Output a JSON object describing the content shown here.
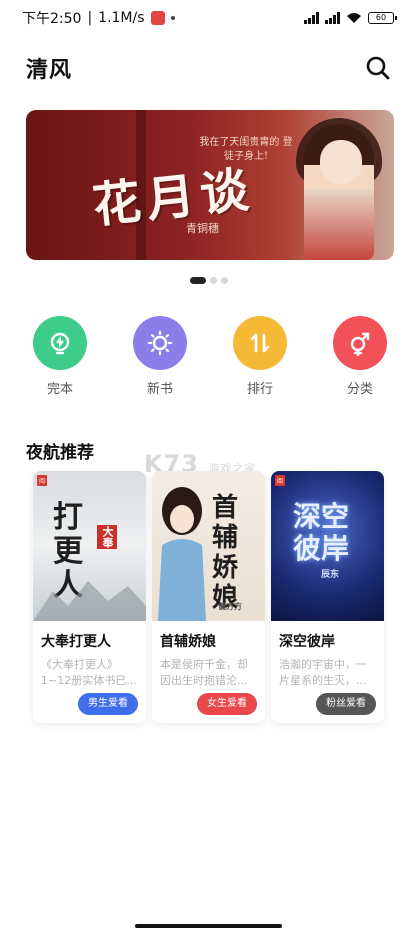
{
  "status_bar": {
    "time": "下午2:50",
    "net_speed": "1.1M/s",
    "battery": "60"
  },
  "header": {
    "title": "清风"
  },
  "banner": {
    "tagline": "我在了天闺贵胄的 登徒子身上!",
    "title": "花月谈",
    "author": "青铜穗"
  },
  "categories": [
    {
      "label": "完本",
      "icon": "lightbulb-icon",
      "color": "#3dcc8a"
    },
    {
      "label": "新书",
      "icon": "sun-icon",
      "color": "#8b7ee8"
    },
    {
      "label": "排行",
      "icon": "sort-arrows-icon",
      "color": "#f5b935"
    },
    {
      "label": "分类",
      "icon": "gender-icon",
      "color": "#f2515a"
    }
  ],
  "section": {
    "title": "夜航推荐"
  },
  "watermark": {
    "text": "K73",
    "sub": "游戏之家"
  },
  "books": [
    {
      "cover_title": "打更人",
      "cover_sub": "大奉",
      "title": "大奉打更人",
      "desc": "《大奉打更人》1~12册实体书已...",
      "tag": "男生爱看",
      "tag_color": "#3f6ee8"
    },
    {
      "cover_title": "首辅娇娘",
      "cover_sub": "偏方方",
      "title": "首辅娇娘",
      "desc": "本是侯府千金，却因出生时抱错沦...",
      "tag": "女生爱看",
      "tag_color": "#e8484c"
    },
    {
      "cover_title": "深空彼岸",
      "cover_sub": "辰东",
      "title": "深空彼岸",
      "desc": "浩瀚的宇宙中，一片星系的生灭，...",
      "tag": "粉丝爱看",
      "tag_color": "#555555"
    }
  ]
}
